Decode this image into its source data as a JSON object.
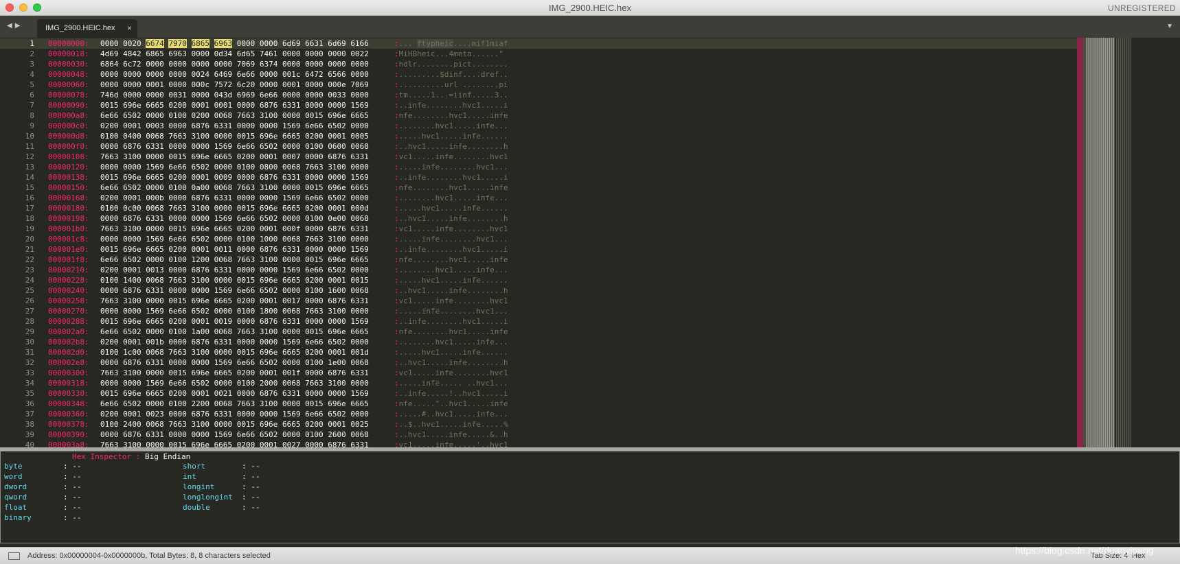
{
  "window": {
    "title": "IMG_2900.HEIC.hex",
    "license": "UNREGISTERED"
  },
  "icons": {
    "close": "close-icon",
    "nav_back": "chevron-left-icon",
    "nav_forward": "chevron-right-icon",
    "tab_menu": "chevron-down-icon",
    "panel": "panel-icon"
  },
  "tab": {
    "label": "IMG_2900.HEIC.hex",
    "close": "×"
  },
  "lines": [
    {
      "n": "1",
      "addr": "00000000:",
      "hex": "0000 0020 6674 7970 6865 6963 0000 0000 6d69 6631 6d69 6166",
      "ascii": "... ftypheic....mif1miaf"
    },
    {
      "n": "2",
      "addr": "00000018:",
      "hex": "4d69 4842 6865 6963 0000 0d34 6d65 7461 0000 0000 0000 0022",
      "ascii": "MiHBheic...4meta......\""
    },
    {
      "n": "3",
      "addr": "00000030:",
      "hex": "6864 6c72 0000 0000 0000 0000 7069 6374 0000 0000 0000 0000",
      "ascii": "hdlr........pict........"
    },
    {
      "n": "4",
      "addr": "00000048:",
      "hex": "0000 0000 0000 0000 0024 6469 6e66 0000 001c 6472 6566 0000",
      "ascii": ".........$dinf....dref.."
    },
    {
      "n": "5",
      "addr": "00000060:",
      "hex": "0000 0000 0001 0000 000c 7572 6c20 0000 0001 0000 000e 7069",
      "ascii": "..........url ........pi"
    },
    {
      "n": "6",
      "addr": "00000078:",
      "hex": "746d 0000 0000 0031 0000 043d 6969 6e66 0000 0000 0033 0000",
      "ascii": "tm.....1...=iinf.....3.."
    },
    {
      "n": "7",
      "addr": "00000090:",
      "hex": "0015 696e 6665 0200 0001 0001 0000 6876 6331 0000 0000 1569",
      "ascii": "..infe........hvc1.....i"
    },
    {
      "n": "8",
      "addr": "000000a8:",
      "hex": "6e66 6502 0000 0100 0200 0068 7663 3100 0000 0015 696e 6665",
      "ascii": "nfe........hvc1.....infe"
    },
    {
      "n": "9",
      "addr": "000000c0:",
      "hex": "0200 0001 0003 0000 6876 6331 0000 0000 1569 6e66 6502 0000",
      "ascii": "........hvc1.....infe..."
    },
    {
      "n": "10",
      "addr": "000000d8:",
      "hex": "0100 0400 0068 7663 3100 0000 0015 696e 6665 0200 0001 0005",
      "ascii": ".....hvc1.....infe......"
    },
    {
      "n": "11",
      "addr": "000000f0:",
      "hex": "0000 6876 6331 0000 0000 1569 6e66 6502 0000 0100 0600 0068",
      "ascii": "..hvc1.....infe........h"
    },
    {
      "n": "12",
      "addr": "00000108:",
      "hex": "7663 3100 0000 0015 696e 6665 0200 0001 0007 0000 6876 6331",
      "ascii": "vc1.....infe........hvc1"
    },
    {
      "n": "13",
      "addr": "00000120:",
      "hex": "0000 0000 1569 6e66 6502 0000 0100 0800 0068 7663 3100 0000",
      "ascii": ".....infe........hvc1..."
    },
    {
      "n": "14",
      "addr": "00000138:",
      "hex": "0015 696e 6665 0200 0001 0009 0000 6876 6331 0000 0000 1569",
      "ascii": "..infe........hvc1.....i"
    },
    {
      "n": "15",
      "addr": "00000150:",
      "hex": "6e66 6502 0000 0100 0a00 0068 7663 3100 0000 0015 696e 6665",
      "ascii": "nfe........hvc1.....infe"
    },
    {
      "n": "16",
      "addr": "00000168:",
      "hex": "0200 0001 000b 0000 6876 6331 0000 0000 1569 6e66 6502 0000",
      "ascii": "........hvc1.....infe..."
    },
    {
      "n": "17",
      "addr": "00000180:",
      "hex": "0100 0c00 0068 7663 3100 0000 0015 696e 6665 0200 0001 000d",
      "ascii": ".....hvc1.....infe......"
    },
    {
      "n": "18",
      "addr": "00000198:",
      "hex": "0000 6876 6331 0000 0000 1569 6e66 6502 0000 0100 0e00 0068",
      "ascii": "..hvc1.....infe........h"
    },
    {
      "n": "19",
      "addr": "000001b0:",
      "hex": "7663 3100 0000 0015 696e 6665 0200 0001 000f 0000 6876 6331",
      "ascii": "vc1.....infe........hvc1"
    },
    {
      "n": "20",
      "addr": "000001c8:",
      "hex": "0000 0000 1569 6e66 6502 0000 0100 1000 0068 7663 3100 0000",
      "ascii": ".....infe........hvc1..."
    },
    {
      "n": "21",
      "addr": "000001e0:",
      "hex": "0015 696e 6665 0200 0001 0011 0000 6876 6331 0000 0000 1569",
      "ascii": "..infe........hvc1.....i"
    },
    {
      "n": "22",
      "addr": "000001f8:",
      "hex": "6e66 6502 0000 0100 1200 0068 7663 3100 0000 0015 696e 6665",
      "ascii": "nfe........hvc1.....infe"
    },
    {
      "n": "23",
      "addr": "00000210:",
      "hex": "0200 0001 0013 0000 6876 6331 0000 0000 1569 6e66 6502 0000",
      "ascii": "........hvc1.....infe..."
    },
    {
      "n": "24",
      "addr": "00000228:",
      "hex": "0100 1400 0068 7663 3100 0000 0015 696e 6665 0200 0001 0015",
      "ascii": ".....hvc1.....infe......"
    },
    {
      "n": "25",
      "addr": "00000240:",
      "hex": "0000 6876 6331 0000 0000 1569 6e66 6502 0000 0100 1600 0068",
      "ascii": "..hvc1.....infe........h"
    },
    {
      "n": "26",
      "addr": "00000258:",
      "hex": "7663 3100 0000 0015 696e 6665 0200 0001 0017 0000 6876 6331",
      "ascii": "vc1.....infe........hvc1"
    },
    {
      "n": "27",
      "addr": "00000270:",
      "hex": "0000 0000 1569 6e66 6502 0000 0100 1800 0068 7663 3100 0000",
      "ascii": ".....infe........hvc1..."
    },
    {
      "n": "28",
      "addr": "00000288:",
      "hex": "0015 696e 6665 0200 0001 0019 0000 6876 6331 0000 0000 1569",
      "ascii": "..infe........hvc1.....i"
    },
    {
      "n": "29",
      "addr": "000002a0:",
      "hex": "6e66 6502 0000 0100 1a00 0068 7663 3100 0000 0015 696e 6665",
      "ascii": "nfe........hvc1.....infe"
    },
    {
      "n": "30",
      "addr": "000002b8:",
      "hex": "0200 0001 001b 0000 6876 6331 0000 0000 1569 6e66 6502 0000",
      "ascii": "........hvc1.....infe..."
    },
    {
      "n": "31",
      "addr": "000002d0:",
      "hex": "0100 1c00 0068 7663 3100 0000 0015 696e 6665 0200 0001 001d",
      "ascii": ".....hvc1.....infe......"
    },
    {
      "n": "32",
      "addr": "000002e8:",
      "hex": "0000 6876 6331 0000 0000 1569 6e66 6502 0000 0100 1e00 0068",
      "ascii": "..hvc1.....infe........h"
    },
    {
      "n": "33",
      "addr": "00000300:",
      "hex": "7663 3100 0000 0015 696e 6665 0200 0001 001f 0000 6876 6331",
      "ascii": "vc1.....infe........hvc1"
    },
    {
      "n": "34",
      "addr": "00000318:",
      "hex": "0000 0000 1569 6e66 6502 0000 0100 2000 0068 7663 3100 0000",
      "ascii": ".....infe..... ..hvc1..."
    },
    {
      "n": "35",
      "addr": "00000330:",
      "hex": "0015 696e 6665 0200 0001 0021 0000 6876 6331 0000 0000 1569",
      "ascii": "..infe.....!..hvc1.....i"
    },
    {
      "n": "36",
      "addr": "00000348:",
      "hex": "6e66 6502 0000 0100 2200 0068 7663 3100 0000 0015 696e 6665",
      "ascii": "nfe.....\"..hvc1.....infe"
    },
    {
      "n": "37",
      "addr": "00000360:",
      "hex": "0200 0001 0023 0000 6876 6331 0000 0000 1569 6e66 6502 0000",
      "ascii": ".....#..hvc1.....infe..."
    },
    {
      "n": "38",
      "addr": "00000378:",
      "hex": "0100 2400 0068 7663 3100 0000 0015 696e 6665 0200 0001 0025",
      "ascii": "..$..hvc1.....infe.....%"
    },
    {
      "n": "39",
      "addr": "00000390:",
      "hex": "0000 6876 6331 0000 0000 1569 6e66 6502 0000 0100 2600 0068",
      "ascii": "..hvc1.....infe.....&..h"
    },
    {
      "n": "40",
      "addr": "000003a8:",
      "hex": "7663 3100 0000 0015 696e 6665 0200 0001 0027 0000 6876 6331",
      "ascii": "vc1.....infe.....'..hvc1"
    }
  ],
  "selection": {
    "hex_words": [
      "6674",
      "7970",
      "6865",
      "6963"
    ],
    "ascii_text": "ftypheic"
  },
  "inspector": {
    "title": "Hex Inspector",
    "colon": ":",
    "endianness": "Big Endian",
    "left": [
      {
        "label": "byte",
        "value": "--"
      },
      {
        "label": "word",
        "value": "--"
      },
      {
        "label": "dword",
        "value": "--"
      },
      {
        "label": "qword",
        "value": "--"
      },
      {
        "label": "float",
        "value": "--"
      },
      {
        "label": "binary",
        "value": "--"
      }
    ],
    "right": [
      {
        "label": "short",
        "value": "--"
      },
      {
        "label": "int",
        "value": "--"
      },
      {
        "label": "longint",
        "value": "--"
      },
      {
        "label": "longlongint",
        "value": "--"
      },
      {
        "label": "double",
        "value": "--"
      }
    ]
  },
  "status": {
    "text": "Address: 0x00000004-0x0000000b, Total Bytes: 8, 8 characters selected",
    "tab_size": "Tab Size: 4",
    "syntax": "Hex"
  },
  "watermark": "https://blog.csdn.net/duanyipeng",
  "colors": {
    "bg": "#272822",
    "address": "#f92672",
    "hex_text": "#f8f8f2",
    "ascii_text": "#75715e",
    "highlight": "#e6db74",
    "inspector_label": "#66d9ef"
  }
}
